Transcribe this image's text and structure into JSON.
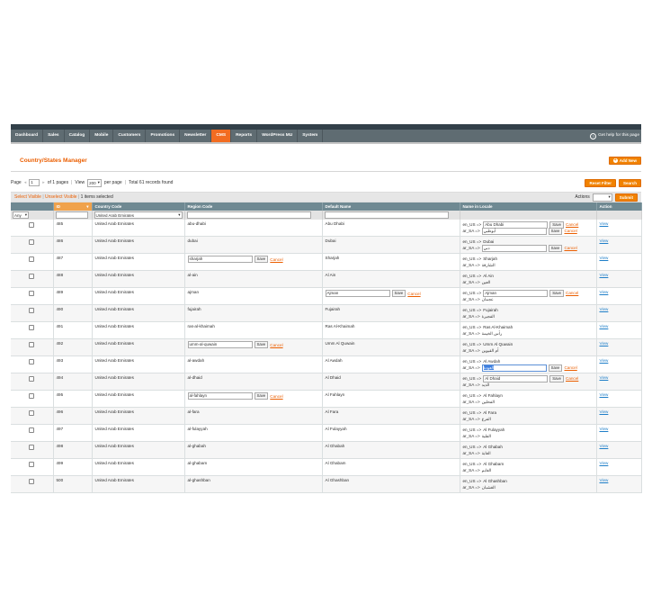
{
  "nav": {
    "items": [
      {
        "label": "Dashboard",
        "active": false
      },
      {
        "label": "Sales",
        "active": false
      },
      {
        "label": "Catalog",
        "active": false
      },
      {
        "label": "Mobile",
        "active": false
      },
      {
        "label": "Customers",
        "active": false
      },
      {
        "label": "Promotions",
        "active": false
      },
      {
        "label": "Newsletter",
        "active": false
      },
      {
        "label": "CMS",
        "active": true
      },
      {
        "label": "Reports",
        "active": false
      },
      {
        "label": "WordPress MU",
        "active": false
      },
      {
        "label": "System",
        "active": false
      }
    ],
    "help_label": "Get help for this page"
  },
  "header": {
    "title": "Country/States Manager",
    "add_new_label": "Add New"
  },
  "pager": {
    "page_label": "Page",
    "page_value": "1",
    "of_pages": "of 1 pages",
    "view_label": "View",
    "per_page_value": "200",
    "per_page_label": "per page",
    "total": "Total 61 records found",
    "reset_filter": "Reset Filter",
    "search": "Search"
  },
  "massaction": {
    "select_visible": "Select Visible",
    "unselect_visible": "Unselect Visible",
    "items_selected": "1 items selected",
    "actions_label": "Actions",
    "submit": "Submit"
  },
  "columns": {
    "id": "ID",
    "country_code": "Country Code",
    "region_code": "Region Code",
    "default_name": "Default Name",
    "name_in_locale": "Name in Locale",
    "action": "Action"
  },
  "filter": {
    "any": "Any",
    "country_value": "United Arab Emirates"
  },
  "buttons": {
    "save": "Save",
    "cancel": "Cancel",
    "view": "View"
  },
  "locale_prefix": {
    "en": "en_US =>",
    "ar": "ar_SA =>"
  },
  "rows": [
    {
      "id": "485",
      "country": "United Arab Emirates",
      "region": "abu-dhabi",
      "default": "Abu Dhabi",
      "en": "Abu Dhabi",
      "ar": "أبوظبي",
      "en_edit": true,
      "ar_edit": true,
      "region_edit": false,
      "default_edit": false
    },
    {
      "id": "486",
      "country": "United Arab Emirates",
      "region": "dubai",
      "default": "Dubai",
      "en": "Dubai",
      "ar": "دبي",
      "en_edit": false,
      "ar_edit": true,
      "region_edit": false,
      "default_edit": false
    },
    {
      "id": "487",
      "country": "United Arab Emirates",
      "region": "sharjah",
      "default": "Sharjah",
      "en": "Sharjah",
      "ar": "الشارقة",
      "en_edit": false,
      "ar_edit": false,
      "region_edit": true,
      "default_edit": false
    },
    {
      "id": "488",
      "country": "United Arab Emirates",
      "region": "al-ain",
      "default": "Al Ain",
      "en": "Al Ain",
      "ar": "العين",
      "en_edit": false,
      "ar_edit": false,
      "region_edit": false,
      "default_edit": false
    },
    {
      "id": "489",
      "country": "United Arab Emirates",
      "region": "ajman",
      "default": "Ajman",
      "en": "Ajman",
      "ar": "عجمان",
      "en_edit": true,
      "ar_edit": false,
      "region_edit": false,
      "default_edit": true
    },
    {
      "id": "490",
      "country": "United Arab Emirates",
      "region": "fujairah",
      "default": "Fujairah",
      "en": "Fujairah",
      "ar": "الفجيرة",
      "en_edit": false,
      "ar_edit": false,
      "region_edit": false,
      "default_edit": false
    },
    {
      "id": "491",
      "country": "United Arab Emirates",
      "region": "ras-al-khaimah",
      "default": "Ras Al-Khaimah",
      "en": "Ras Al-Khaimah",
      "ar": "رأس الخيمة",
      "en_edit": false,
      "ar_edit": false,
      "region_edit": false,
      "default_edit": false
    },
    {
      "id": "492",
      "country": "United Arab Emirates",
      "region": "umm-al-quwain",
      "default": "Umm Al Quwain",
      "en": "Umm Al Quwain",
      "ar": "أم القيوين",
      "en_edit": false,
      "ar_edit": false,
      "region_edit": true,
      "default_edit": false
    },
    {
      "id": "493",
      "country": "United Arab Emirates",
      "region": "al-awdah",
      "default": "Al Awdah",
      "en": "Al Awdah",
      "ar": "العودة",
      "en_edit": false,
      "ar_edit": true,
      "ar_focused": true,
      "region_edit": false,
      "default_edit": false
    },
    {
      "id": "494",
      "country": "United Arab Emirates",
      "region": "al-dhaid",
      "default": "Al Dhaid",
      "en": "Al Dhaid",
      "ar": "الذيد",
      "en_edit": true,
      "ar_edit": false,
      "region_edit": false,
      "default_edit": false
    },
    {
      "id": "495",
      "country": "United Arab Emirates",
      "region": "al-fahlayn",
      "default": "Al Fahlayn",
      "en": "Al Fahlayn",
      "ar": "الفحلين",
      "en_edit": false,
      "ar_edit": false,
      "region_edit": true,
      "default_edit": false
    },
    {
      "id": "496",
      "country": "United Arab Emirates",
      "region": "al-fara",
      "default": "Al Fara",
      "en": "Al Fara",
      "ar": "الفرع",
      "en_edit": false,
      "ar_edit": false,
      "region_edit": false,
      "default_edit": false
    },
    {
      "id": "497",
      "country": "United Arab Emirates",
      "region": "al-fulayyah",
      "default": "Al Fulayyah",
      "en": "Al Fulayyah",
      "ar": "الفلية",
      "en_edit": false,
      "ar_edit": false,
      "region_edit": false,
      "default_edit": false
    },
    {
      "id": "498",
      "country": "United Arab Emirates",
      "region": "al-ghabah",
      "default": "Al Ghabah",
      "en": "Al Ghabah",
      "ar": "الغابة",
      "en_edit": false,
      "ar_edit": false,
      "region_edit": false,
      "default_edit": false
    },
    {
      "id": "499",
      "country": "United Arab Emirates",
      "region": "al-ghabam",
      "default": "Al Ghabam",
      "en": "Al Ghabam",
      "ar": "الغابم",
      "en_edit": false,
      "ar_edit": false,
      "region_edit": false,
      "default_edit": false
    },
    {
      "id": "500",
      "country": "United Arab Emirates",
      "region": "al-ghashban",
      "default": "Al Ghashban",
      "en": "Al Ghashban",
      "ar": "الغشبان",
      "en_edit": false,
      "ar_edit": false,
      "region_edit": false,
      "default_edit": false
    }
  ]
}
